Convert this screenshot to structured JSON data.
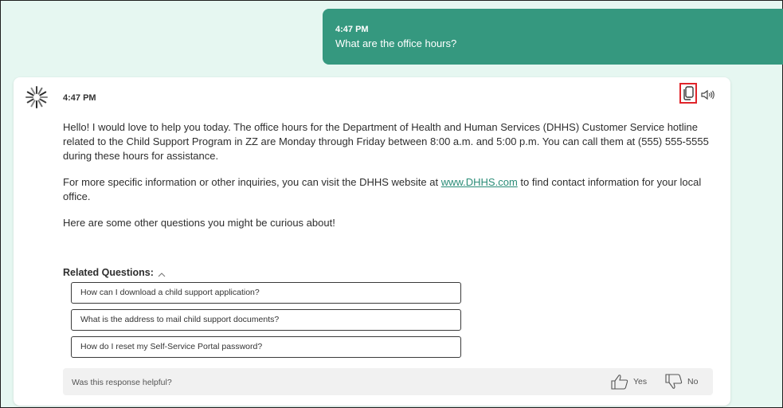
{
  "user_message": {
    "time": "4:47 PM",
    "text": "What are the office hours?"
  },
  "bot_message": {
    "time": "4:47 PM",
    "paragraph1": "Hello! I would love to help you today. The office hours for the Department of Health and Human Services (DHHS) Customer Service hotline related to the Child Support Program in ZZ are Monday through Friday between 8:00 a.m. and 5:00 p.m. You can call them at (555) 555-5555 during these hours for assistance.",
    "paragraph2_before": "For more specific information or other inquiries, you can visit the DHHS website at ",
    "paragraph2_link": "www.DHHS.com",
    "paragraph2_after": " to find contact information for your local office.",
    "paragraph3": "Here are some other questions you might be curious about!",
    "icons": {
      "logo": "starburst-logo",
      "copy": "copy-icon",
      "speaker": "speaker-icon"
    }
  },
  "related": {
    "title": "Related Questions:",
    "questions": [
      "How can I download a child support application?",
      "What is the address to mail child support documents?",
      "How do I reset my Self-Service Portal password?"
    ]
  },
  "feedback": {
    "prompt": "Was this response helpful?",
    "yes_label": "Yes",
    "no_label": "No"
  },
  "colors": {
    "accent": "#35987f",
    "background": "#e6f7f1",
    "highlight_border": "#e0242a",
    "link": "#2a8c77"
  }
}
